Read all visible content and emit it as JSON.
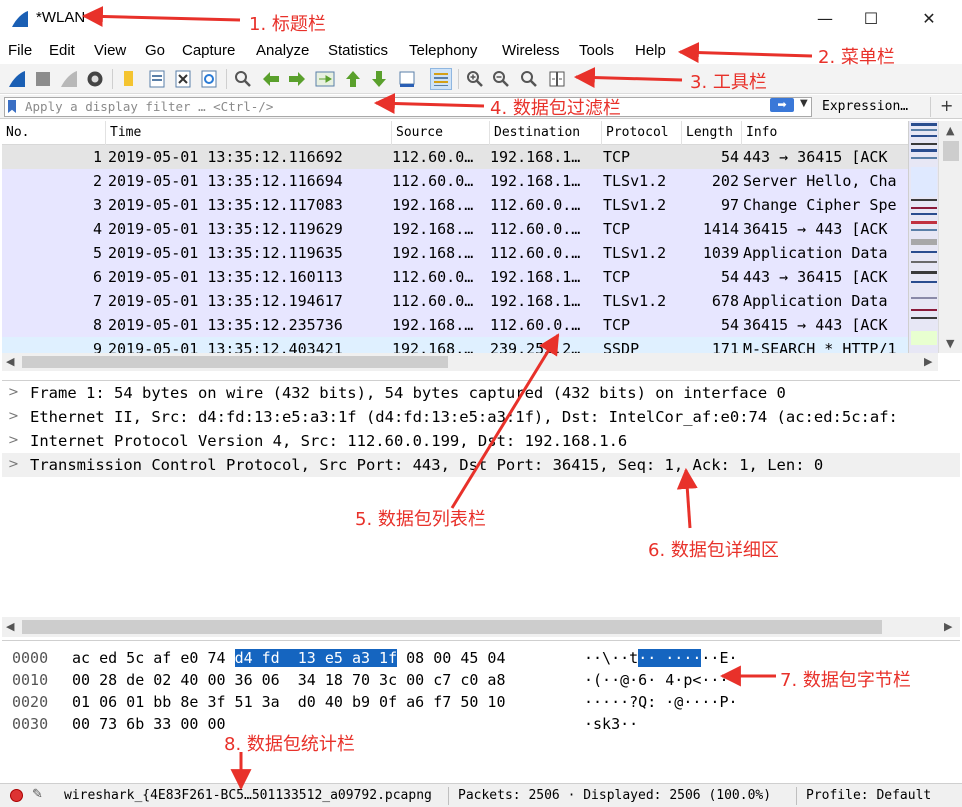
{
  "window": {
    "title": "*WLAN",
    "minimize": "—",
    "maximize": "☐",
    "close": "✕"
  },
  "menu": [
    "File",
    "Edit",
    "View",
    "Go",
    "Capture",
    "Analyze",
    "Statistics",
    "Telephony",
    "Wireless",
    "Tools",
    "Help"
  ],
  "toolbar_icons": [
    "shark-fin-start-icon",
    "stop-icon",
    "restart-icon",
    "capture-options-icon",
    "open-file-icon",
    "file-icon",
    "close-file-icon",
    "reload-icon",
    "find-icon",
    "back-icon",
    "forward-icon",
    "go-to-packet-icon",
    "first-packet-icon",
    "last-packet-icon",
    "autoscroll-icon",
    "colorize-icon",
    "zoom-in-icon",
    "zoom-out-icon",
    "zoom-reset-icon",
    "resize-columns-icon"
  ],
  "filter": {
    "placeholder": "Apply a display filter … <Ctrl-/>",
    "expression_label": "Expression…",
    "plus_label": "+"
  },
  "packet_list": {
    "columns": [
      "No.",
      "Time",
      "Source",
      "Destination",
      "Protocol",
      "Length",
      "Info"
    ],
    "rows": [
      {
        "no": "1",
        "time": "2019-05-01 13:35:12.116692",
        "src": "112.60.0…",
        "dst": "192.168.1…",
        "proto": "TCP",
        "len": "54",
        "info": "443 → 36415 [ACK"
      },
      {
        "no": "2",
        "time": "2019-05-01 13:35:12.116694",
        "src": "112.60.0…",
        "dst": "192.168.1…",
        "proto": "TLSv1.2",
        "len": "202",
        "info": "Server Hello, Cha"
      },
      {
        "no": "3",
        "time": "2019-05-01 13:35:12.117083",
        "src": "192.168.…",
        "dst": "112.60.0.…",
        "proto": "TLSv1.2",
        "len": "97",
        "info": "Change Cipher Spe"
      },
      {
        "no": "4",
        "time": "2019-05-01 13:35:12.119629",
        "src": "192.168.…",
        "dst": "112.60.0.…",
        "proto": "TCP",
        "len": "1414",
        "info": "36415 → 443 [ACK"
      },
      {
        "no": "5",
        "time": "2019-05-01 13:35:12.119635",
        "src": "192.168.…",
        "dst": "112.60.0.…",
        "proto": "TLSv1.2",
        "len": "1039",
        "info": "Application Data"
      },
      {
        "no": "6",
        "time": "2019-05-01 13:35:12.160113",
        "src": "112.60.0…",
        "dst": "192.168.1…",
        "proto": "TCP",
        "len": "54",
        "info": "443 → 36415 [ACK"
      },
      {
        "no": "7",
        "time": "2019-05-01 13:35:12.194617",
        "src": "112.60.0…",
        "dst": "192.168.1…",
        "proto": "TLSv1.2",
        "len": "678",
        "info": "Application Data"
      },
      {
        "no": "8",
        "time": "2019-05-01 13:35:12.235736",
        "src": "192.168.…",
        "dst": "112.60.0.…",
        "proto": "TCP",
        "len": "54",
        "info": "36415 → 443 [ACK"
      },
      {
        "no": "9",
        "time": "2019-05-01 13:35:12.403421",
        "src": "192.168.…",
        "dst": "239.255.2…",
        "proto": "SSDP",
        "len": "171",
        "info": "M-SEARCH * HTTP/1"
      }
    ],
    "row_colors": [
      "#e4e4e4",
      "#e7e6ff",
      "#e7e6ff",
      "#e7e6ff",
      "#e7e6ff",
      "#e7e6ff",
      "#e7e6ff",
      "#e7e6ff",
      "#dff0ff"
    ]
  },
  "details": [
    "Frame 1: 54 bytes on wire (432 bits), 54 bytes captured (432 bits) on interface 0",
    "Ethernet II, Src: d4:fd:13:e5:a3:1f (d4:fd:13:e5:a3:1f), Dst: IntelCor_af:e0:74 (ac:ed:5c:af:",
    "Internet Protocol Version 4, Src: 112.60.0.199, Dst: 192.168.1.6",
    "Transmission Control Protocol, Src Port: 443, Dst Port: 36415, Seq: 1, Ack: 1, Len: 0"
  ],
  "bytes": [
    {
      "off": "0000",
      "hex_pre": "ac ed 5c af e0 74 ",
      "hex_hl": "d4 fd  13 e5 a3 1f",
      "hex_post": " 08 00 45 04",
      "asc_pre": "··\\··t",
      "asc_hl": "·· ····",
      "asc_post": "··E·"
    },
    {
      "off": "0010",
      "hex_pre": "00 28 de 02 40 00 36 06  34 18 70 3c 00 c7 c0 a8",
      "hex_hl": "",
      "hex_post": "",
      "asc_pre": "·(··@·6· 4·p<····",
      "asc_hl": "",
      "asc_post": ""
    },
    {
      "off": "0020",
      "hex_pre": "01 06 01 bb 8e 3f 51 3a  d0 40 b9 0f a6 f7 50 10",
      "hex_hl": "",
      "hex_post": "",
      "asc_pre": "·····?Q: ·@····P·",
      "asc_hl": "",
      "asc_post": ""
    },
    {
      "off": "0030",
      "hex_pre": "00 73 6b 33 00 00",
      "hex_hl": "",
      "hex_post": "",
      "asc_pre": "·sk3··",
      "asc_hl": "",
      "asc_post": ""
    }
  ],
  "status": {
    "file": "wireshark_{4E83F261-BC5…501133512_a09792.pcapng",
    "packets": "Packets: 2506 · Displayed: 2506 (100.0%)",
    "profile": "Profile: Default"
  },
  "annotations": {
    "a1": "1. 标题栏",
    "a2": "2. 菜单栏",
    "a3": "3. 工具栏",
    "a4": "4. 数据包过滤栏",
    "a5": "5. 数据包列表栏",
    "a6": "6. 数据包详细区",
    "a7": "7. 数据包字节栏",
    "a8": "8. 数据包统计栏",
    "color": "#e8312a"
  }
}
